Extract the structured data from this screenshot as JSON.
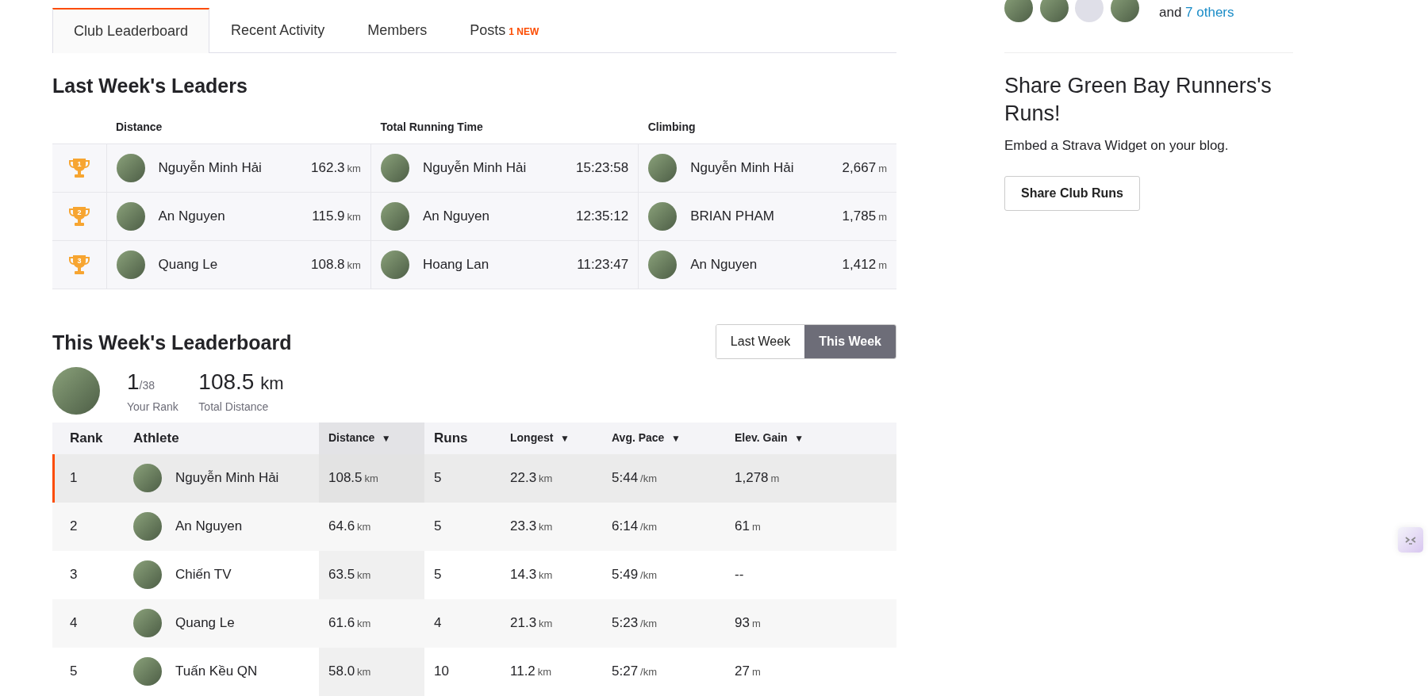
{
  "tabs": [
    {
      "label": "Club Leaderboard",
      "selected": true
    },
    {
      "label": "Recent Activity",
      "selected": false
    },
    {
      "label": "Members",
      "selected": false
    },
    {
      "label": "Posts",
      "badge": "1 NEW",
      "selected": false
    }
  ],
  "last_week": {
    "title": "Last Week's Leaders",
    "columns": [
      "Distance",
      "Total Running Time",
      "Climbing"
    ],
    "rows": [
      {
        "rank": "1",
        "cells": [
          {
            "athlete": "Nguyễn Minh Hải",
            "value": "162.3",
            "unit": "km"
          },
          {
            "athlete": "Nguyễn Minh Hải",
            "value": "15:23:58"
          },
          {
            "athlete": "Nguyễn Minh Hải",
            "value": "2,667",
            "unit": "m"
          }
        ]
      },
      {
        "rank": "2",
        "cells": [
          {
            "athlete": "An Nguyen",
            "value": "115.9",
            "unit": "km"
          },
          {
            "athlete": "An Nguyen",
            "value": "12:35:12"
          },
          {
            "athlete": "BRIAN PHAM",
            "value": "1,785",
            "unit": "m"
          }
        ]
      },
      {
        "rank": "3",
        "cells": [
          {
            "athlete": "Quang Le",
            "value": "108.8",
            "unit": "km"
          },
          {
            "athlete": "Hoang Lan",
            "value": "11:23:47"
          },
          {
            "athlete": "An Nguyen",
            "value": "1,412",
            "unit": "m"
          }
        ]
      }
    ]
  },
  "this_week": {
    "title": "This Week's Leaderboard",
    "toggle": [
      {
        "label": "Last Week",
        "selected": false
      },
      {
        "label": "This Week",
        "selected": true
      }
    ],
    "summary": {
      "rank": "1",
      "rank_total": "/38",
      "rank_label": "Your Rank",
      "distance": "108.5",
      "distance_unit": "km",
      "distance_label": "Total Distance"
    },
    "columns": [
      {
        "label": "Rank",
        "sorted": false
      },
      {
        "label": "Athlete",
        "sorted": false
      },
      {
        "label": "Distance",
        "arrow": "▼",
        "sorted": true
      },
      {
        "label": "Runs",
        "sorted": false
      },
      {
        "label": "Longest",
        "arrow": "▼",
        "sorted": false
      },
      {
        "label": "Avg. Pace",
        "arrow": "▼",
        "sorted": false
      },
      {
        "label": "Elev. Gain",
        "arrow": "▼",
        "sorted": false
      }
    ],
    "rows": [
      {
        "rank": "1",
        "athlete": "Nguyễn Minh Hải",
        "distance": "108.5",
        "distance_unit": "km",
        "runs": "5",
        "longest": "22.3",
        "longest_unit": "km",
        "pace": "5:44",
        "pace_unit": "/km",
        "elev": "1,278",
        "elev_unit": "m",
        "selected": true
      },
      {
        "rank": "2",
        "athlete": "An Nguyen",
        "distance": "64.6",
        "distance_unit": "km",
        "runs": "5",
        "longest": "23.3",
        "longest_unit": "km",
        "pace": "6:14",
        "pace_unit": "/km",
        "elev": "61",
        "elev_unit": "m",
        "selected": false
      },
      {
        "rank": "3",
        "athlete": "Chiến TV",
        "distance": "63.5",
        "distance_unit": "km",
        "runs": "5",
        "longest": "14.3",
        "longest_unit": "km",
        "pace": "5:49",
        "pace_unit": "/km",
        "elev": "--",
        "selected": false
      },
      {
        "rank": "4",
        "athlete": "Quang Le",
        "distance": "61.6",
        "distance_unit": "km",
        "runs": "4",
        "longest": "21.3",
        "longest_unit": "km",
        "pace": "5:23",
        "pace_unit": "/km",
        "elev": "93",
        "elev_unit": "m",
        "selected": false
      },
      {
        "rank": "5",
        "athlete": "Tuấn Kều QN",
        "distance": "58.0",
        "distance_unit": "km",
        "runs": "10",
        "longest": "11.2",
        "longest_unit": "km",
        "pace": "5:27",
        "pace_unit": "/km",
        "elev": "27",
        "elev_unit": "m",
        "selected": false
      }
    ]
  },
  "members": {
    "avatars": [
      {
        "kind": "photo"
      },
      {
        "kind": "photo"
      },
      {
        "kind": "default"
      },
      {
        "kind": "photo"
      }
    ],
    "text": "and",
    "link": "7 others"
  },
  "share": {
    "title": "Share Green Bay Runners's Runs!",
    "text": "Embed a Strava Widget on your blog.",
    "button": "Share Club Runs"
  }
}
